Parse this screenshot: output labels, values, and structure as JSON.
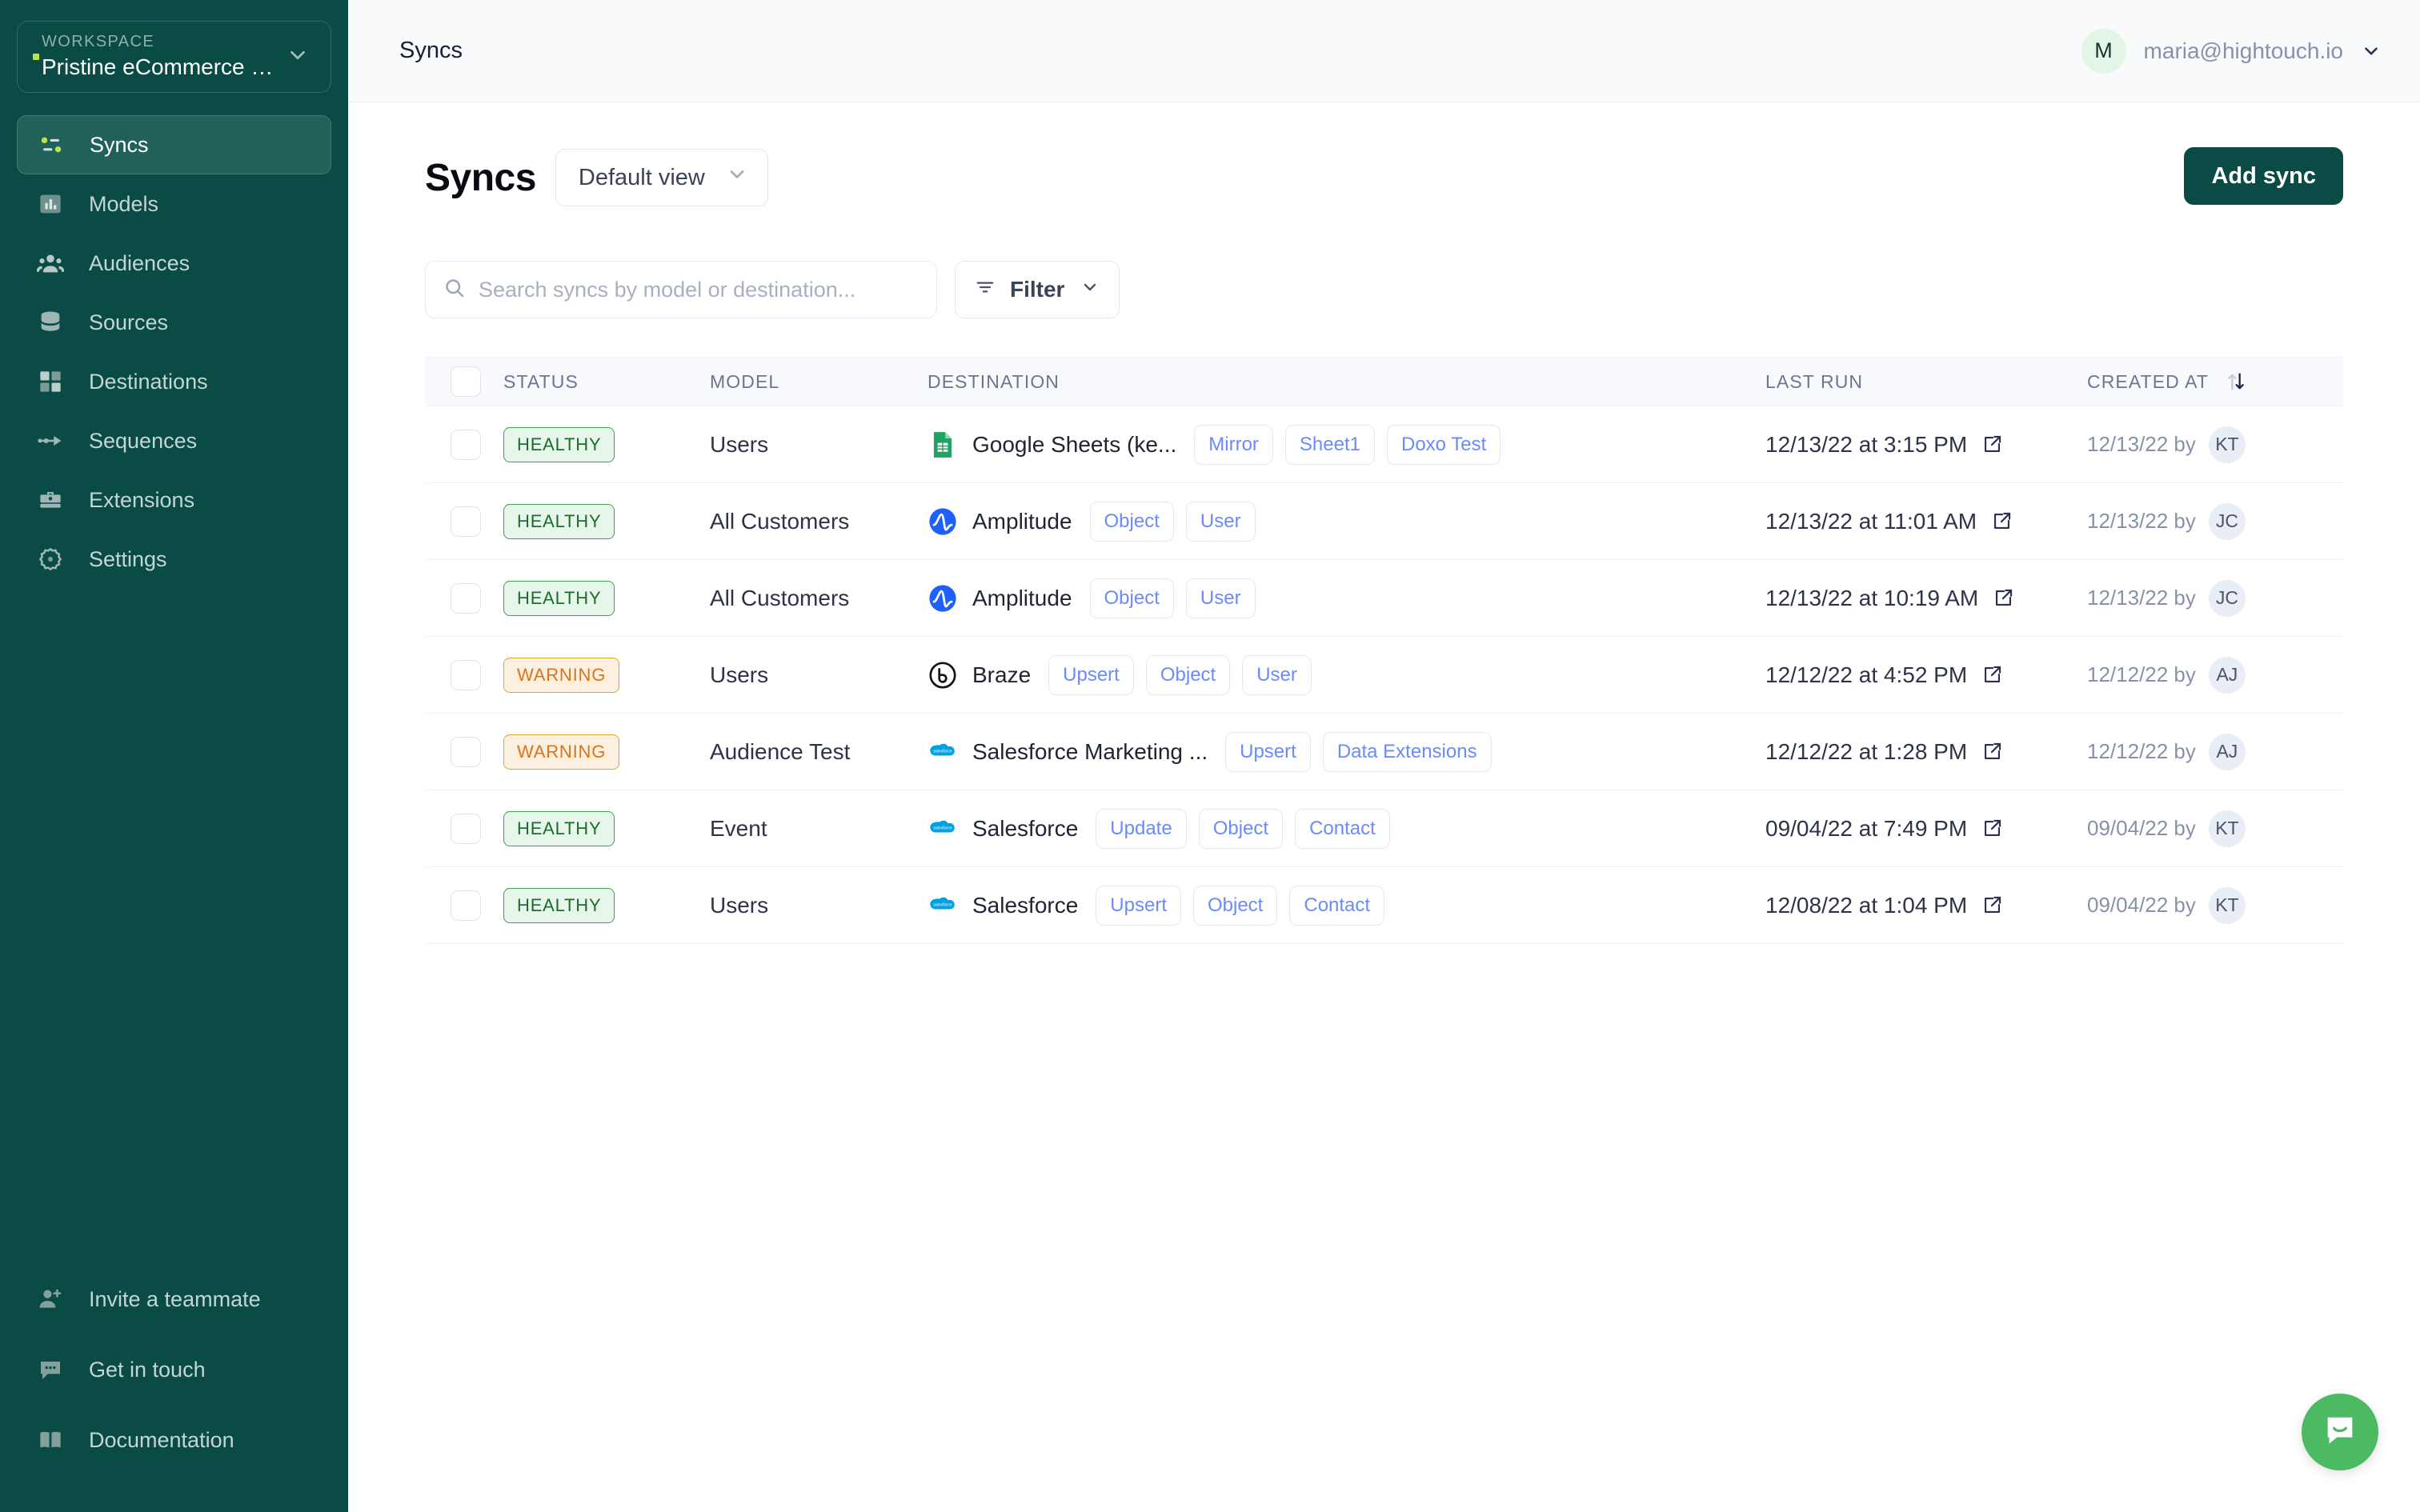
{
  "sidebar": {
    "workspace_label": "WORKSPACE",
    "workspace_name": "Pristine eCommerce Demo",
    "items": [
      {
        "label": "Syncs",
        "icon": "syncs-icon",
        "active": true
      },
      {
        "label": "Models",
        "icon": "models-icon",
        "active": false
      },
      {
        "label": "Audiences",
        "icon": "audiences-icon",
        "active": false
      },
      {
        "label": "Sources",
        "icon": "sources-icon",
        "active": false
      },
      {
        "label": "Destinations",
        "icon": "destinations-icon",
        "active": false
      },
      {
        "label": "Sequences",
        "icon": "sequences-icon",
        "active": false
      },
      {
        "label": "Extensions",
        "icon": "extensions-icon",
        "active": false
      },
      {
        "label": "Settings",
        "icon": "settings-icon",
        "active": false
      }
    ],
    "bottom_items": [
      {
        "label": "Invite a teammate",
        "icon": "user-plus-icon"
      },
      {
        "label": "Get in touch",
        "icon": "chat-icon"
      },
      {
        "label": "Documentation",
        "icon": "book-icon"
      }
    ]
  },
  "topbar": {
    "title": "Syncs",
    "user_initial": "M",
    "user_email": "maria@hightouch.io"
  },
  "page": {
    "title": "Syncs",
    "view_selector": "Default view",
    "add_sync_label": "Add sync"
  },
  "search": {
    "placeholder": "Search syncs by model or destination...",
    "value": ""
  },
  "filter": {
    "label": "Filter"
  },
  "table": {
    "columns": [
      "STATUS",
      "MODEL",
      "DESTINATION",
      "LAST RUN",
      "CREATED AT"
    ],
    "rows": [
      {
        "status": "HEALTHY",
        "status_kind": "healthy",
        "model": "Users",
        "destination": "Google Sheets (ke...",
        "dest_icon": "google-sheets-icon",
        "pills": [
          "Mirror",
          "Sheet1",
          "Doxo Test"
        ],
        "last_run": "12/13/22 at 3:15 PM",
        "created_at": "12/13/22 by",
        "created_by": "KT",
        "more": false
      },
      {
        "status": "HEALTHY",
        "status_kind": "healthy",
        "model": "All Customers",
        "destination": "Amplitude",
        "dest_icon": "amplitude-icon",
        "pills": [
          "Object",
          "User"
        ],
        "last_run": "12/13/22 at 11:01 AM",
        "created_at": "12/13/22 by",
        "created_by": "JC",
        "more": false
      },
      {
        "status": "HEALTHY",
        "status_kind": "healthy",
        "model": "All Customers",
        "destination": "Amplitude",
        "dest_icon": "amplitude-icon",
        "pills": [
          "Object",
          "User"
        ],
        "last_run": "12/13/22 at 10:19 AM",
        "created_at": "12/13/22 by",
        "created_by": "JC",
        "more": false
      },
      {
        "status": "WARNING",
        "status_kind": "warning",
        "model": "Users",
        "destination": "Braze",
        "dest_icon": "braze-icon",
        "pills": [
          "Upsert",
          "Object",
          "User"
        ],
        "last_run": "12/12/22 at 4:52 PM",
        "created_at": "12/12/22 by",
        "created_by": "AJ",
        "more": false
      },
      {
        "status": "WARNING",
        "status_kind": "warning",
        "model": "Audience Test",
        "destination": "Salesforce Marketing ...",
        "dest_icon": "salesforce-icon",
        "pills": [
          "Upsert",
          "Data Extensions"
        ],
        "last_run": "12/12/22 at 1:28 PM",
        "created_at": "12/12/22 by",
        "created_by": "AJ",
        "more": false
      },
      {
        "status": "HEALTHY",
        "status_kind": "healthy",
        "model": "Event",
        "destination": "Salesforce",
        "dest_icon": "salesforce-icon",
        "pills": [
          "Update",
          "Object",
          "Contact"
        ],
        "last_run": "09/04/22 at 7:49 PM",
        "created_at": "09/04/22 by",
        "created_by": "KT",
        "more": true
      },
      {
        "status": "HEALTHY",
        "status_kind": "healthy",
        "model": "Users",
        "destination": "Salesforce",
        "dest_icon": "salesforce-icon",
        "pills": [
          "Upsert",
          "Object",
          "Contact"
        ],
        "last_run": "12/08/22 at 1:04 PM",
        "created_at": "09/04/22 by",
        "created_by": "KT",
        "more": true
      }
    ]
  },
  "colors": {
    "sidebar_bg": "#0b4b45",
    "accent_green": "#b9e54b",
    "primary_button": "#0b4b45",
    "healthy": "#3f9f4d",
    "warning": "#e6a030",
    "pill_text": "#6b8afd",
    "chat_fab": "#4cb963"
  }
}
